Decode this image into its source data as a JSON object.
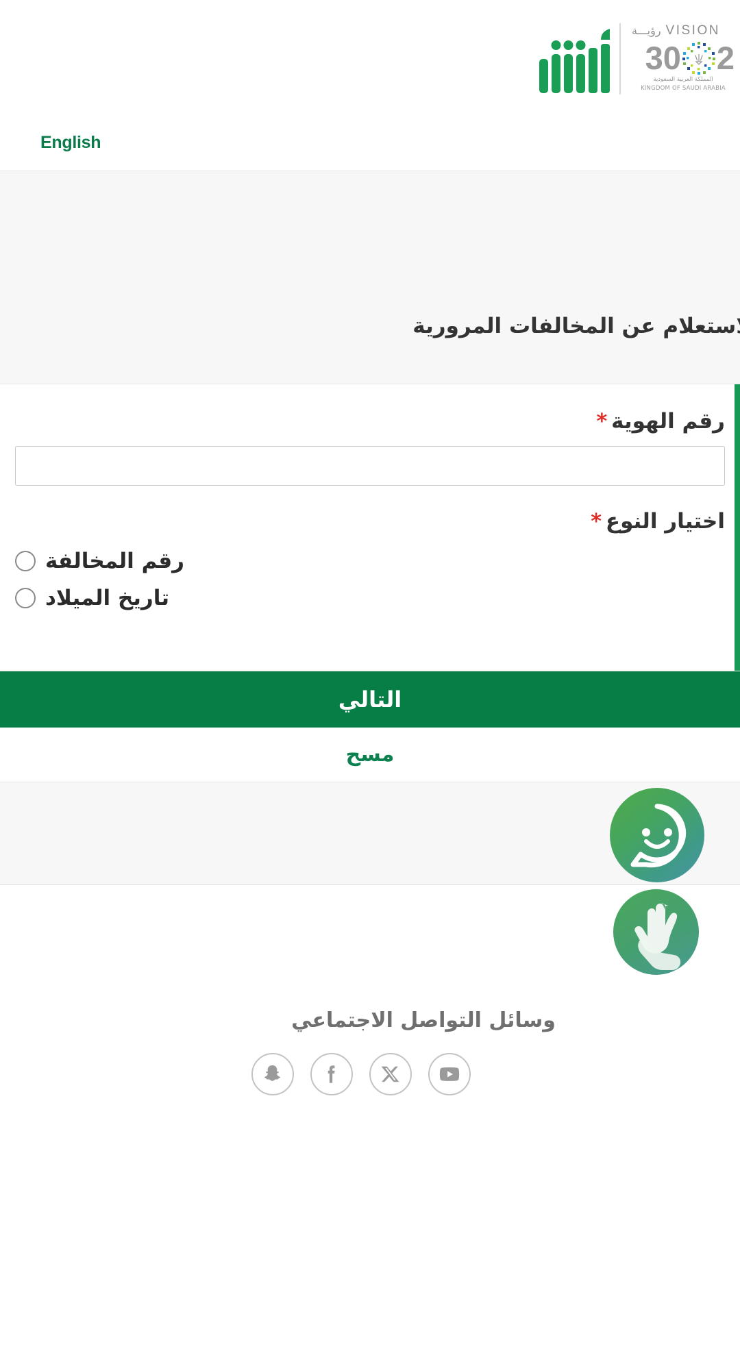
{
  "brand": {
    "absher_logo_alt": "أبشر",
    "vision": {
      "word_en": "VISION",
      "word_ar": "رؤيـــة",
      "digit_left": "2",
      "digit_right": "30",
      "sub_ar": "المملكة العربية السعودية",
      "sub_en": "KINGDOM OF SAUDI ARABIA"
    }
  },
  "nav": {
    "language_link": "English"
  },
  "main": {
    "page_title": "الاستعلام عن المخالفات المرورية"
  },
  "form": {
    "id_number": {
      "label": "رقم الهوية",
      "required_mark": "*",
      "value": "",
      "placeholder": ""
    },
    "type_selector": {
      "label": "اختيار النوع",
      "required_mark": "*",
      "options": [
        {
          "label": "رقم المخالفة",
          "selected": false
        },
        {
          "label": "تاريخ الميلاد",
          "selected": false
        }
      ]
    }
  },
  "actions": {
    "next_label": "التالي",
    "clear_label": "مسح"
  },
  "widgets": {
    "chat_assistant_name": "chat-assistant-avatar",
    "sign_language_name": "sign-language-service"
  },
  "footer": {
    "social_heading": "وسائل التواصل الاجتماعي",
    "social_links": [
      {
        "name": "snapchat-icon"
      },
      {
        "name": "facebook-icon"
      },
      {
        "name": "x-twitter-icon"
      },
      {
        "name": "youtube-icon"
      }
    ]
  },
  "colors": {
    "brand_green": "#067e46",
    "accent_green": "#179a56",
    "link_green": "#0a7c4a",
    "required_red": "#e02b27",
    "page_bg": "#f7f7f7"
  }
}
